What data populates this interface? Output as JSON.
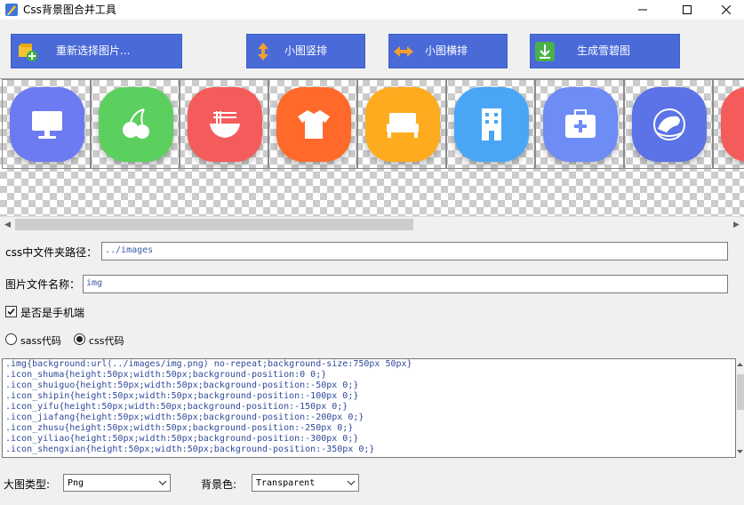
{
  "window": {
    "title": "Css背景图合并工具"
  },
  "toolbar": {
    "reselect_label": "重新选择图片...",
    "vertical_label": "小图竖排",
    "horizontal_label": "小图横排",
    "generate_label": "生成雪碧图"
  },
  "icons": [
    {
      "name": "computer-icon",
      "color": "#6c7bf2"
    },
    {
      "name": "fruit-icon",
      "color": "#5bd05f"
    },
    {
      "name": "noodle-bowl-icon",
      "color": "#f45c5c"
    },
    {
      "name": "shirt-icon",
      "color": "#ff6a2a"
    },
    {
      "name": "bed-icon",
      "color": "#ffab20"
    },
    {
      "name": "building-icon",
      "color": "#49a6f5"
    },
    {
      "name": "medical-kit-icon",
      "color": "#6e8cf5"
    },
    {
      "name": "shrimp-icon",
      "color": "#5b73e6"
    },
    {
      "name": "partial-icon",
      "color": "#f45c5c"
    }
  ],
  "form": {
    "css_path_label": "css中文件夹路径：",
    "css_path_value": "../images",
    "image_name_label": "图片文件名称：",
    "image_name_value": "img",
    "mobile_label": "是否是手机端",
    "mobile_checked": true,
    "sass_label": "sass代码",
    "css_label": "css代码",
    "selected_mode": "css"
  },
  "code_lines": [
    ".img{background:url(../images/img.png)  no-repeat;background-size:750px 50px}",
    ".icon_shuma{height:50px;width:50px;background-position:0 0;}",
    ".icon_shuiguo{height:50px;width:50px;background-position:-50px 0;}",
    ".icon_shipin{height:50px;width:50px;background-position:-100px 0;}",
    ".icon_yifu{height:50px;width:50px;background-position:-150px 0;}",
    ".icon_jiafang{height:50px;width:50px;background-position:-200px 0;}",
    ".icon_zhusu{height:50px;width:50px;background-position:-250px 0;}",
    ".icon_yiliao{height:50px;width:50px;background-position:-300px 0;}",
    ".icon_shengxian{height:50px;width:50px;background-position:-350px 0;}"
  ],
  "bottom": {
    "image_type_label": "大图类型:",
    "image_type_value": "Png",
    "bgcolor_label": "背景色:",
    "bgcolor_value": "Transparent"
  }
}
